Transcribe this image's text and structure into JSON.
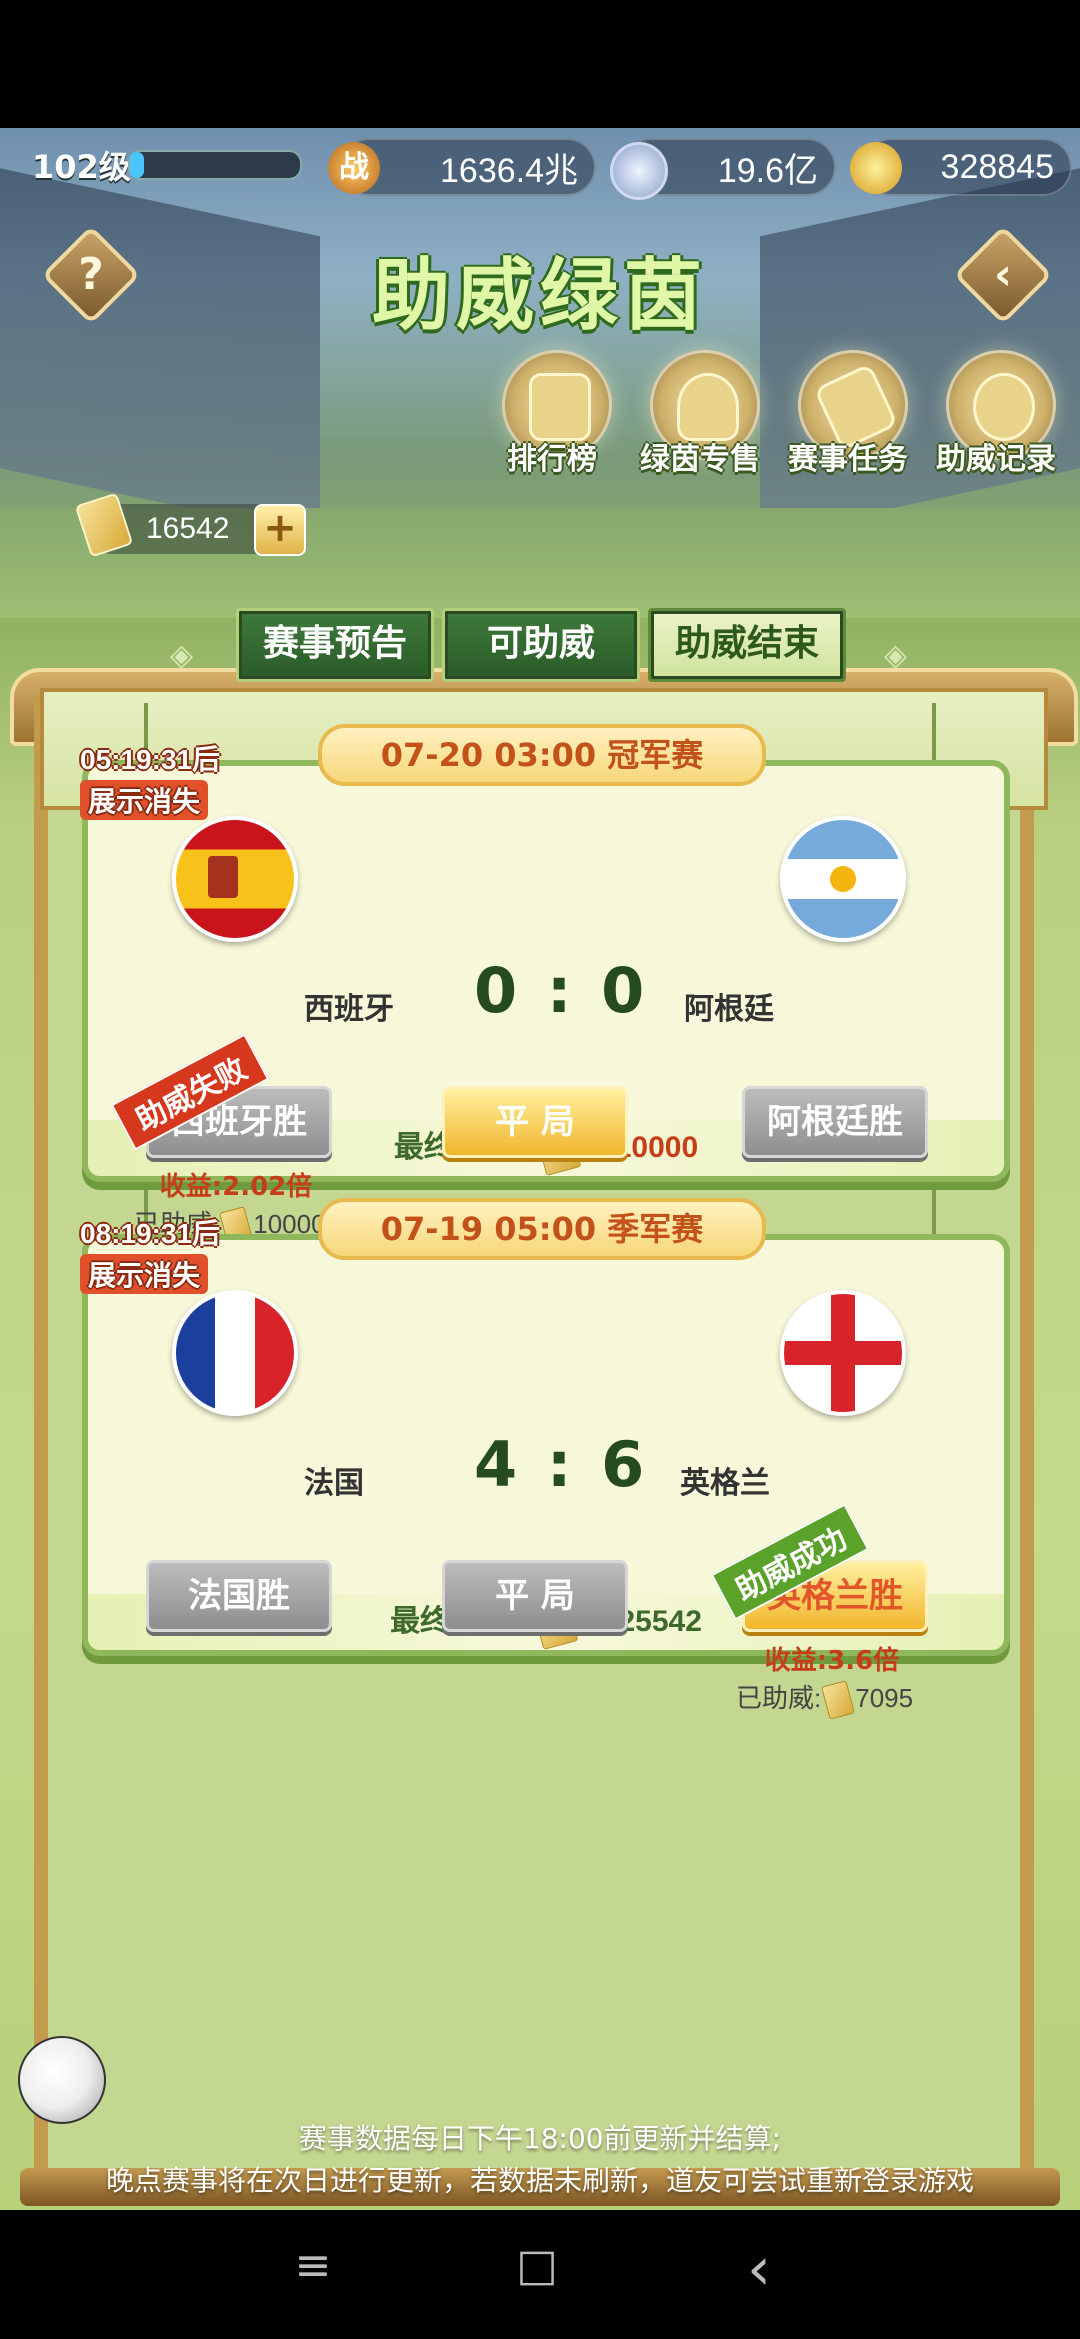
{
  "topbar": {
    "level": "102级",
    "power": "1636.4兆",
    "silver": "19.6亿",
    "gold": "328845",
    "power_icon_char": "战"
  },
  "header": {
    "title": "助威绿茵",
    "help_icon": "question-mark-icon",
    "back_icon": "back-chevron-icon"
  },
  "features": [
    {
      "label": "排行榜",
      "icon": "leaderboard-icon"
    },
    {
      "label": "绿茵专售",
      "icon": "shop-bag-icon"
    },
    {
      "label": "赛事任务",
      "icon": "scroll-task-icon"
    },
    {
      "label": "助威记录",
      "icon": "medal-record-icon"
    }
  ],
  "tickets": {
    "count": "16542",
    "add_label": "+"
  },
  "tabs": [
    {
      "label": "赛事预告",
      "active": false
    },
    {
      "label": "可助威",
      "active": false
    },
    {
      "label": "助威结束",
      "active": true
    }
  ],
  "matches": [
    {
      "timer": "05:19:31后",
      "timer_sub": "展示消失",
      "title": "07-20 03:00 冠军赛",
      "home": "西班牙",
      "away": "阿根廷",
      "score": "0 : 0",
      "buttons": [
        "西班牙胜",
        "平 局",
        "阿根廷胜"
      ],
      "stamp": "助威失败",
      "profit": "收益:2.02倍",
      "backed_label": "已助威:",
      "backed_amount": "10000",
      "final_label": "最终收益:",
      "final_value": "-10000"
    },
    {
      "timer": "08:19:31后",
      "timer_sub": "展示消失",
      "title": "07-19 05:00 季军赛",
      "home": "法国",
      "away": "英格兰",
      "score": "4 : 6",
      "buttons": [
        "法国胜",
        "平 局",
        "英格兰胜"
      ],
      "stamp": "助威成功",
      "profit": "收益:3.6倍",
      "backed_label": "已助威:",
      "backed_amount": "7095",
      "final_label": "最终收益:",
      "final_value": "+25542"
    }
  ],
  "notice": {
    "line1": "赛事数据每日下午18:00前更新并结算;",
    "line2": "晚点赛事将在次日进行更新，若数据未刷新，道友可尝试重新登录游戏"
  },
  "navbar": {
    "menu": "≡",
    "home": "□",
    "back": "‹"
  },
  "colors": {
    "accent": "#2e6a1e",
    "loss": "#d5381c",
    "win": "#5aa22a",
    "gold": "#f1b62c"
  }
}
